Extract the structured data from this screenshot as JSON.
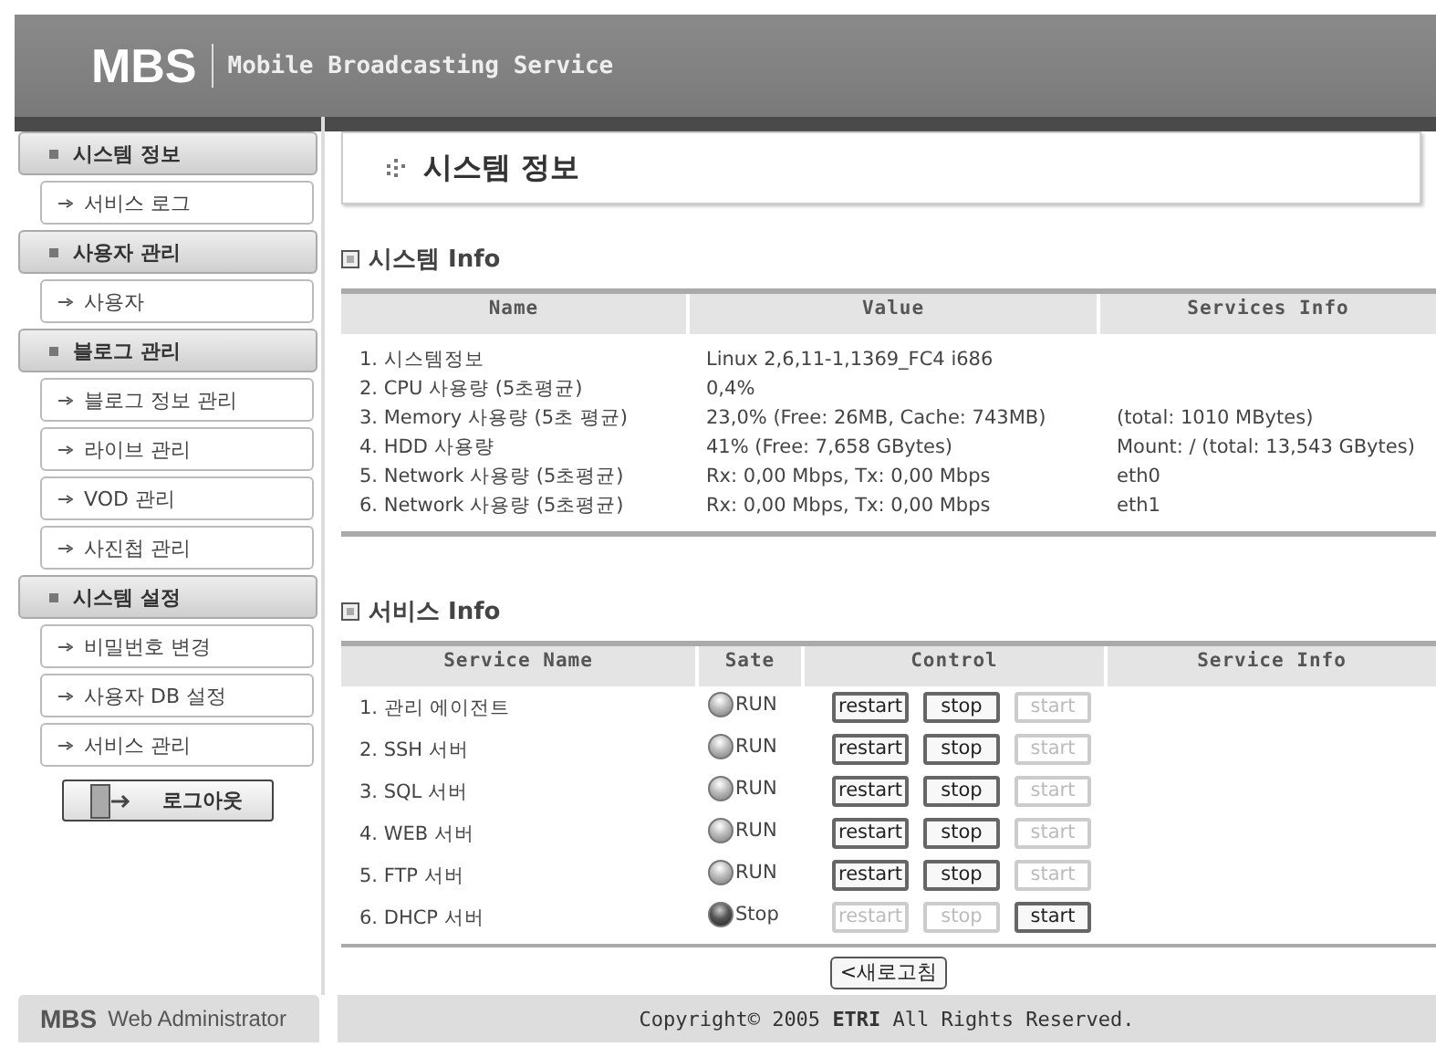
{
  "header": {
    "logo": "MBS",
    "subtitle": "Mobile Broadcasting Service"
  },
  "sidebar": {
    "groups": [
      {
        "title": "시스템 정보",
        "items": [
          "서비스 로그"
        ]
      },
      {
        "title": "사용자 관리",
        "items": [
          "사용자"
        ]
      },
      {
        "title": "블로그 관리",
        "items": [
          "블로그 정보 관리",
          "라이브 관리",
          "VOD 관리",
          "사진첩 관리"
        ]
      },
      {
        "title": "시스템 설정",
        "items": [
          "비밀번호 변경",
          "사용자 DB 설정",
          "서비스 관리"
        ]
      }
    ],
    "logout": "로그아웃"
  },
  "page_title": "시스템 정보",
  "system_info": {
    "heading": "시스템 Info",
    "columns": [
      "Name",
      "Value",
      "Services Info"
    ],
    "rows": [
      {
        "name": "1. 시스템정보",
        "value": "Linux 2,6,11-1,1369_FC4 i686"
      },
      {
        "name": "2. CPU 사용량 (5초평균)",
        "value": "0,4%"
      },
      {
        "name": "3. Memory 사용량 (5초 평균)",
        "value": "23,0% (Free: 26MB, Cache: 743MB)",
        "info": "(total: 1010 MBytes)"
      },
      {
        "name": "4. HDD 사용량",
        "value": "41% (Free: 7,658 GBytes)",
        "info": "Mount: / (total: 13,543 GBytes)"
      },
      {
        "name": "5. Network 사용량 (5초평균)",
        "value": "Rx: 0,00 Mbps, Tx: 0,00 Mbps",
        "info": "eth0"
      },
      {
        "name": "6. Network 사용량 (5초평균)",
        "value": "Rx: 0,00 Mbps, Tx: 0,00 Mbps",
        "info": "eth1"
      }
    ]
  },
  "services": {
    "heading": "서비스 Info",
    "columns": [
      "Service Name",
      "Sate",
      "Control",
      "Service Info"
    ],
    "rows": [
      {
        "name": "1. 관리 에이전트",
        "state": "RUN",
        "running": true,
        "controls": [
          {
            "label": "restart",
            "disabled": false
          },
          {
            "label": "stop",
            "disabled": false
          },
          {
            "label": "start",
            "disabled": true
          }
        ]
      },
      {
        "name": "2. SSH 서버",
        "state": "RUN",
        "running": true,
        "controls": [
          {
            "label": "restart",
            "disabled": false
          },
          {
            "label": "stop",
            "disabled": false
          },
          {
            "label": "start",
            "disabled": true
          }
        ]
      },
      {
        "name": "3. SQL 서버",
        "state": "RUN",
        "running": true,
        "controls": [
          {
            "label": "restart",
            "disabled": false
          },
          {
            "label": "stop",
            "disabled": false
          },
          {
            "label": "start",
            "disabled": true
          }
        ]
      },
      {
        "name": "4. WEB 서버",
        "state": "RUN",
        "running": true,
        "controls": [
          {
            "label": "restart",
            "disabled": false
          },
          {
            "label": "stop",
            "disabled": false
          },
          {
            "label": "start",
            "disabled": true
          }
        ]
      },
      {
        "name": "5. FTP 서버",
        "state": "RUN",
        "running": true,
        "controls": [
          {
            "label": "restart",
            "disabled": false
          },
          {
            "label": "stop",
            "disabled": false
          },
          {
            "label": "start",
            "disabled": true
          }
        ]
      },
      {
        "name": "6. DHCP 서버",
        "state": "Stop",
        "running": false,
        "controls": [
          {
            "label": "restart",
            "disabled": true
          },
          {
            "label": "stop",
            "disabled": true
          },
          {
            "label": "start",
            "disabled": false
          }
        ]
      }
    ]
  },
  "refresh": "<새로고침",
  "footer": {
    "brand": "MBS",
    "product": "Web Administrator",
    "copyright": "Copyright© 2005 **ETRI** All Rights Reserved."
  }
}
